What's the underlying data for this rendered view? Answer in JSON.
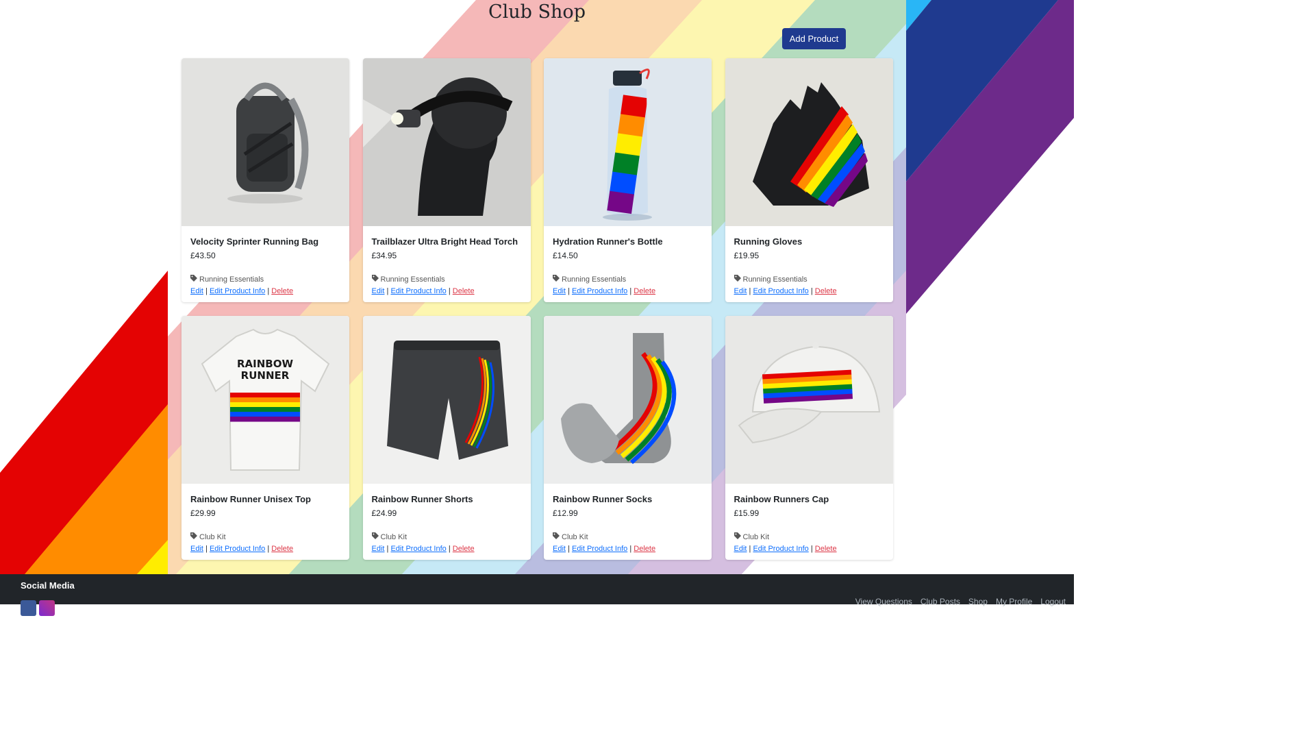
{
  "page": {
    "title": "Club Shop"
  },
  "toolbar": {
    "add_product_label": "Add Product"
  },
  "colors": {
    "rainbow": [
      "#e40303",
      "#ff8c00",
      "#ffed00",
      "#008026",
      "#004dff",
      "#750787"
    ],
    "pastel": [
      "#f5b8b8",
      "#fbd9b0",
      "#fdf6b0",
      "#b4dcbe",
      "#c6e9f6",
      "#b9bde0",
      "#d5bfe0"
    ],
    "navy": "#1f3a8f",
    "purple": "#6d2a8a",
    "cyan": "#29b6f6",
    "button": "#1f3a8f",
    "footer": "#212529"
  },
  "products": [
    {
      "name": "Velocity Sprinter Running Bag",
      "price": "£43.50",
      "category": "Running Essentials",
      "image": "backpack",
      "image_bg": "#e2e2e0"
    },
    {
      "name": "Trailblazer Ultra Bright Head Torch",
      "price": "£34.95",
      "category": "Running Essentials",
      "image": "head-torch",
      "image_bg": "#cfcfcd"
    },
    {
      "name": "Hydration Runner's Bottle",
      "price": "£14.50",
      "category": "Running Essentials",
      "image": "water-bottle",
      "image_bg": "#dfe7ee"
    },
    {
      "name": "Running Gloves",
      "price": "£19.95",
      "category": "Running Essentials",
      "image": "gloves",
      "image_bg": "#e3e2dc"
    },
    {
      "name": "Rainbow Runner Unisex Top",
      "price": "£29.99",
      "category": "Club Kit",
      "image": "t-shirt",
      "image_bg": "#ececea"
    },
    {
      "name": "Rainbow Runner Shorts",
      "price": "£24.99",
      "category": "Club Kit",
      "image": "shorts",
      "image_bg": "#f0f0ef"
    },
    {
      "name": "Rainbow Runner Socks",
      "price": "£12.99",
      "category": "Club Kit",
      "image": "socks",
      "image_bg": "#eceded"
    },
    {
      "name": "Rainbow Runners Cap",
      "price": "£15.99",
      "category": "Club Kit",
      "image": "cap",
      "image_bg": "#e8e8e6"
    }
  ],
  "actions": {
    "edit": "Edit",
    "edit_info": "Edit Product Info",
    "delete": "Delete",
    "separator": "|"
  },
  "footer": {
    "heading": "Social Media",
    "social": [
      "facebook-icon",
      "instagram-icon"
    ],
    "nav": [
      "View Questions",
      "Club Posts",
      "Shop",
      "My Profile",
      "Logout"
    ]
  }
}
